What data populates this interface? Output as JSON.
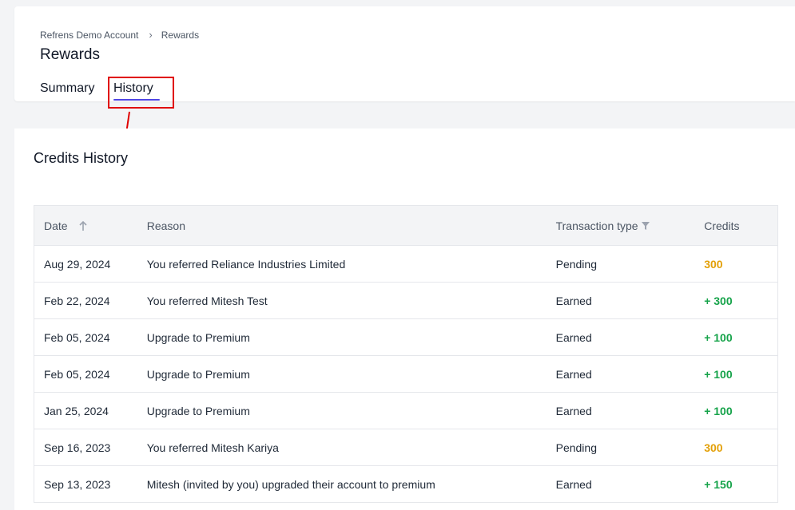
{
  "breadcrumb": {
    "account": "Refrens Demo Account",
    "current": "Rewards"
  },
  "page": {
    "title": "Rewards"
  },
  "tabs": [
    {
      "label": "Summary",
      "active": false
    },
    {
      "label": "History",
      "active": true
    }
  ],
  "credits_history": {
    "title": "Credits History",
    "columns": {
      "date": "Date",
      "reason": "Reason",
      "transaction_type": "Transaction type",
      "credits": "Credits"
    },
    "rows": [
      {
        "date": "Aug 29, 2024",
        "reason": "You referred Reliance Industries Limited",
        "type": "Pending",
        "credits": "300"
      },
      {
        "date": "Feb 22, 2024",
        "reason": "You referred Mitesh Test",
        "type": "Earned",
        "credits": "+ 300"
      },
      {
        "date": "Feb 05, 2024",
        "reason": "Upgrade to Premium",
        "type": "Earned",
        "credits": "+ 100"
      },
      {
        "date": "Feb 05, 2024",
        "reason": "Upgrade to Premium",
        "type": "Earned",
        "credits": "+ 100"
      },
      {
        "date": "Jan 25, 2024",
        "reason": "Upgrade to Premium",
        "type": "Earned",
        "credits": "+ 100"
      },
      {
        "date": "Sep 16, 2023",
        "reason": "You referred Mitesh Kariya",
        "type": "Pending",
        "credits": "300"
      },
      {
        "date": "Sep 13, 2023",
        "reason": "Mitesh (invited by you) upgraded their account to premium",
        "type": "Earned",
        "credits": "+ 150"
      }
    ]
  },
  "colors": {
    "pending": "#e3a008",
    "earned": "#16a34a",
    "accent": "#4f46e5",
    "highlight": "#e00000"
  },
  "icons": {
    "sort": "arrow-up-icon",
    "filter": "filter-icon",
    "breadcrumb_separator": "chevron-right-icon"
  }
}
